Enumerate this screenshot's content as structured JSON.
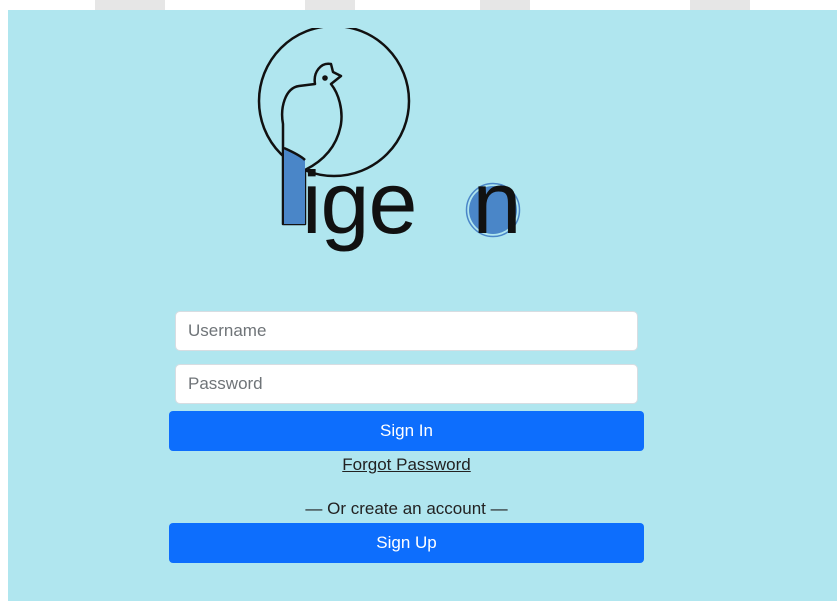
{
  "logo": {
    "wordmark": "igeon",
    "accent_color": "#4a86c8"
  },
  "form": {
    "username_placeholder": "Username",
    "password_placeholder": "Password",
    "sign_in_label": "Sign In",
    "forgot_password_label": "Forgot Password",
    "divider_text": "— Or create an account —",
    "sign_up_label": "Sign Up"
  },
  "colors": {
    "background": "#b0e6ef",
    "primary_button": "#0d6efd"
  }
}
